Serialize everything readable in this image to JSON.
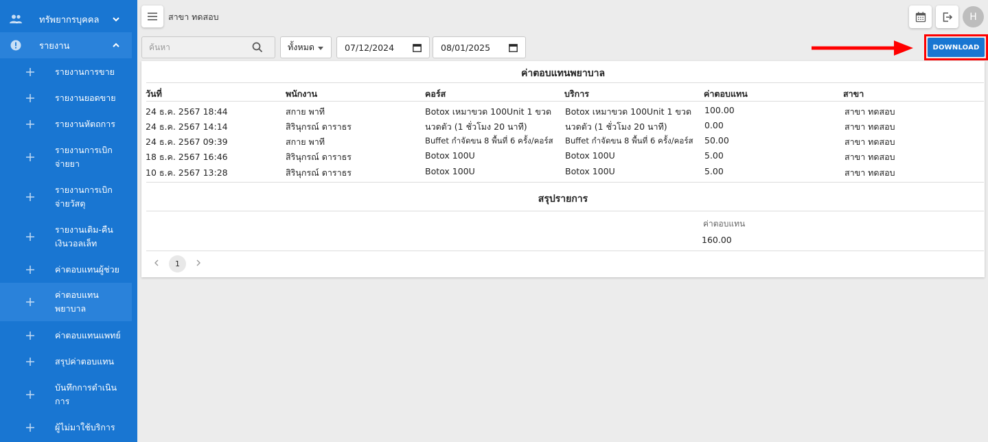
{
  "sidebar": {
    "groups": [
      {
        "label": "ทรัพยากรบุคคล",
        "icon": "people-icon"
      },
      {
        "label": "รายงาน",
        "icon": "alert-circle-icon"
      }
    ],
    "items": [
      {
        "label": "รายงานการขาย"
      },
      {
        "label": "รายงานยอดขาย"
      },
      {
        "label": "รายงานหัตถการ"
      },
      {
        "label": "รายงานการเบิกจ่ายยา"
      },
      {
        "label": "รายงานการเบิกจ่ายวัสดุ"
      },
      {
        "label": "รายงานเติม-คืนเงินวอลเล็ท"
      },
      {
        "label": "ค่าตอบแทนผู้ช่วย"
      },
      {
        "label": "ค่าตอบแทนพยาบาล"
      },
      {
        "label": "ค่าตอบแทนแพทย์"
      },
      {
        "label": "สรุปค่าตอบแทน"
      },
      {
        "label": "บันทึกการดำเนินการ"
      },
      {
        "label": "ผู้ไม่มาใช้บริการ"
      }
    ]
  },
  "header": {
    "branch": "สาขา ทดสอบ",
    "avatar_initial": "H"
  },
  "filters": {
    "search_placeholder": "ค้นหา",
    "select_value": "ทั้งหมด",
    "date_from": "07/12/2024",
    "date_to": "08/01/2025",
    "download_label": "DOWNLOAD"
  },
  "report": {
    "title": "ค่าตอบแทนพยาบาล",
    "columns": [
      "วันที่",
      "พนักงาน",
      "คอร์ส",
      "บริการ",
      "ค่าตอบแทน",
      "สาขา"
    ],
    "rows": [
      [
        "24 ธ.ค. 2567 18:44",
        "สกาย พาที",
        "Botox เหมาขวด 100Unit 1 ขวด",
        "Botox เหมาขวด 100Unit 1 ขวด",
        "100.00",
        "สาขา ทดสอบ"
      ],
      [
        "24 ธ.ค. 2567 14:14",
        "สิรินุกรณ์ ดาราธร",
        "นวดตัว (1 ชั่วโมง 20 นาที)",
        "นวดตัว (1 ชั่วโมง 20 นาที)",
        "0.00",
        "สาขา ทดสอบ"
      ],
      [
        "24 ธ.ค. 2567 09:39",
        "สกาย พาที",
        "Buffet กำจัดขน 8 พื้นที่ 6 ครั้ง/คอร์ส",
        "Buffet กำจัดขน 8 พื้นที่ 6 ครั้ง/คอร์ส",
        "50.00",
        "สาขา ทดสอบ"
      ],
      [
        "18 ธ.ค. 2567 16:46",
        "สิรินุกรณ์ ดาราธร",
        "Botox 100U",
        "Botox 100U",
        "5.00",
        "สาขา ทดสอบ"
      ],
      [
        "10 ธ.ค. 2567 13:28",
        "สิรินุกรณ์ ดาราธร",
        "Botox 100U",
        "Botox 100U",
        "5.00",
        "สาขา ทดสอบ"
      ]
    ],
    "summary_title": "สรุปรายการ",
    "summary_label": "ค่าตอบแทน",
    "summary_value": "160.00",
    "page": "1"
  },
  "colors": {
    "sidebar": "#1976d2",
    "highlight": "#ff0000"
  }
}
